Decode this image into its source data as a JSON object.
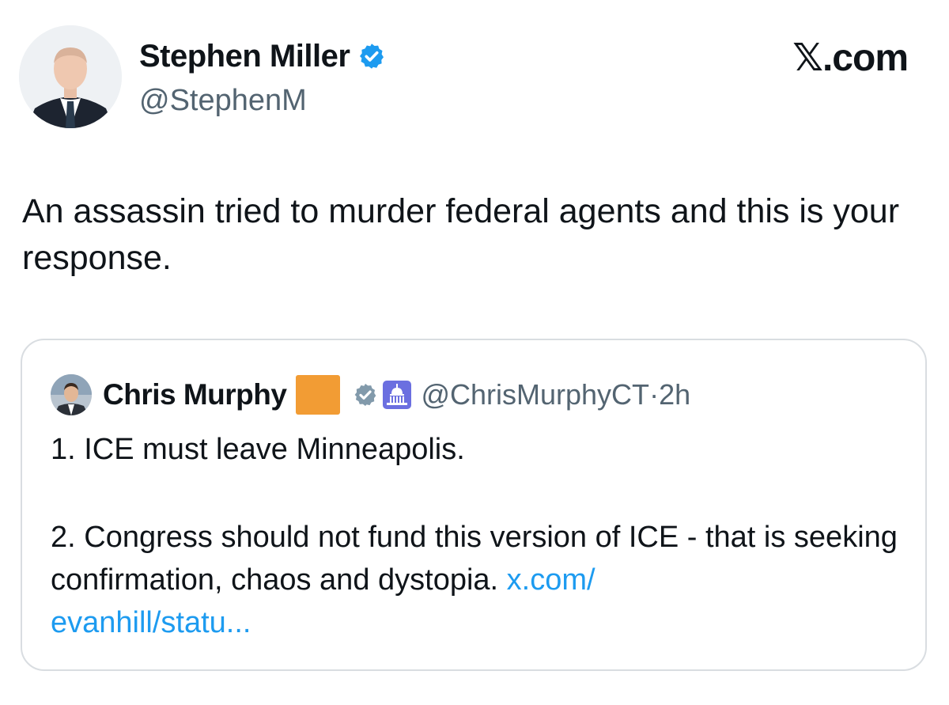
{
  "post": {
    "author": {
      "display_name": "Stephen Miller",
      "handle": "@StephenM",
      "verified": true
    },
    "brand": "𝕏.com",
    "text": "An assassin tried to murder federal agents and this is your response."
  },
  "quoted": {
    "author": {
      "display_name": "Chris Murphy",
      "handle": "@ChrisMurphyCT",
      "time": "2h",
      "separator": "·",
      "verified": true
    },
    "line1": "1. ICE must leave Minneapolis.",
    "line2_text": "2. Congress should not fund this version of ICE - that is seeking confirmation, chaos and dystopia. ",
    "link_text": "x.com/\nevanhill/statu..."
  },
  "colors": {
    "verified_badge": "#1d9bf0",
    "quoted_badge": "#829aab",
    "link": "#1d9bf0",
    "orange_square": "#f29c34",
    "capitol_bg": "#6b6fe0"
  },
  "icons": [
    "verified-badge-icon",
    "orange-square-icon",
    "gray-verified-badge-icon",
    "capitol-icon",
    "x-logo"
  ]
}
